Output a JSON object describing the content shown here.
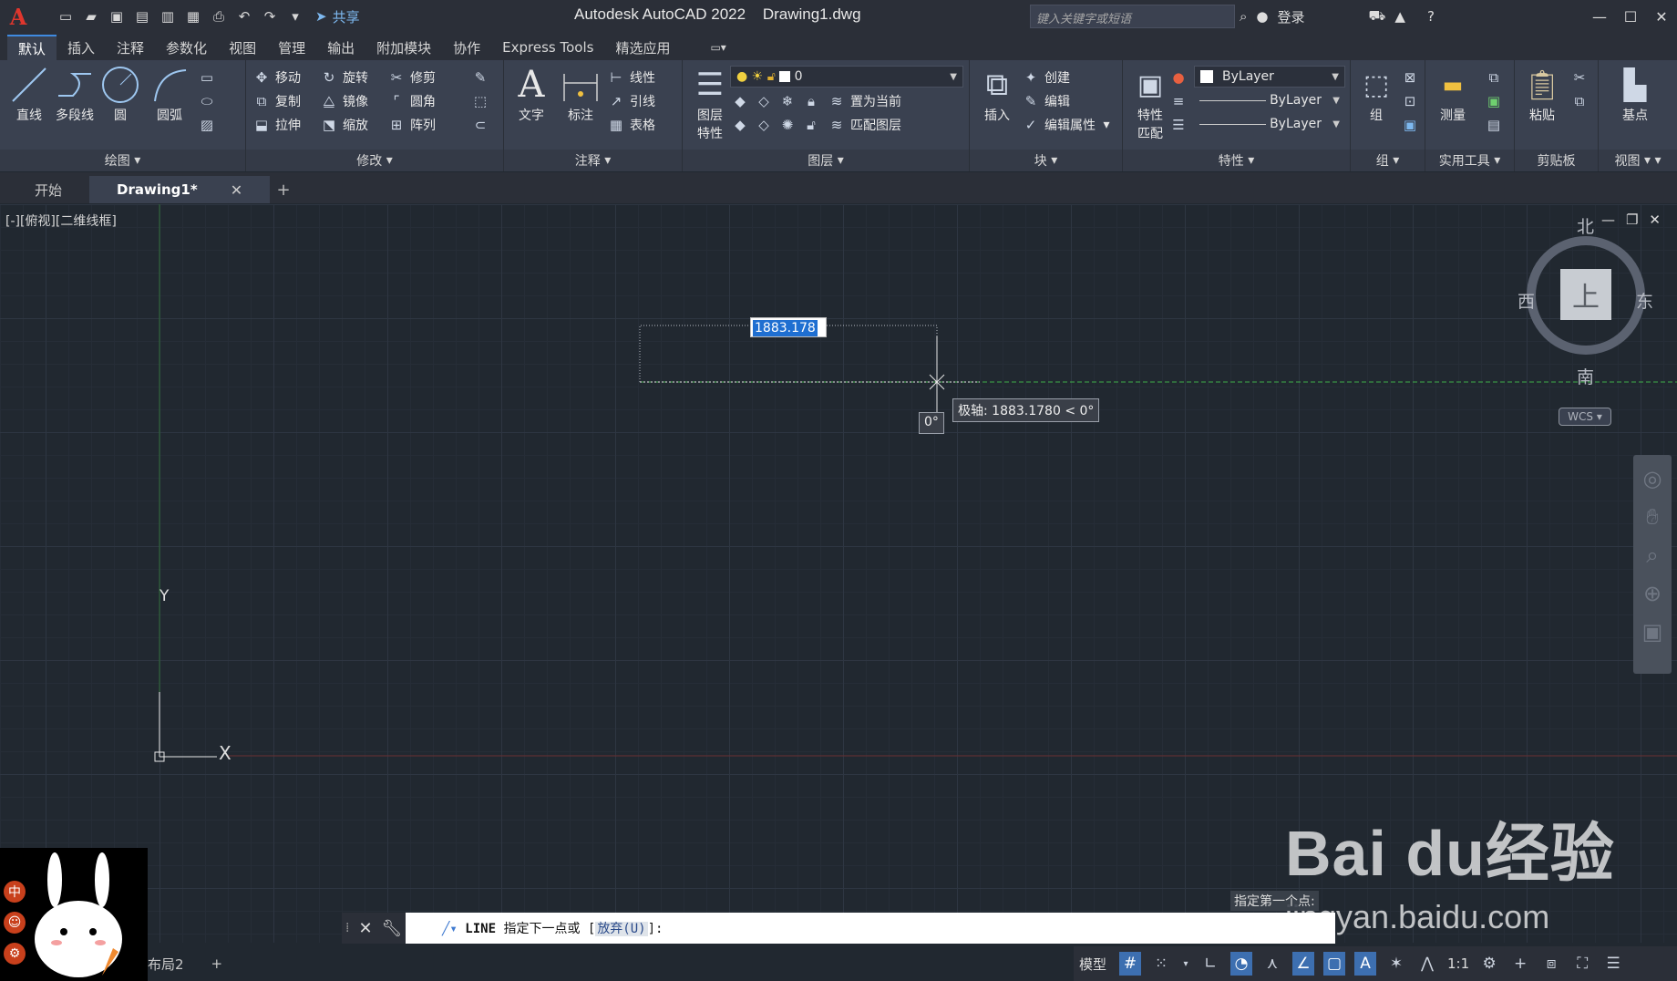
{
  "titlebar": {
    "logo": "A",
    "share_label": "共享",
    "app_title": "Autodesk AutoCAD 2022",
    "doc_title": "Drawing1.dwg",
    "search_placeholder": "键入关键字或短语",
    "login_label": "登录"
  },
  "ribbon_tabs": [
    "默认",
    "插入",
    "注释",
    "参数化",
    "视图",
    "管理",
    "输出",
    "附加模块",
    "协作",
    "Express Tools",
    "精选应用"
  ],
  "ribbon": {
    "draw": {
      "title": "绘图",
      "line": "直线",
      "polyline": "多段线",
      "circle": "圆",
      "arc": "圆弧"
    },
    "modify": {
      "title": "修改",
      "move": "移动",
      "rotate": "旋转",
      "trim": "修剪",
      "copy": "复制",
      "mirror": "镜像",
      "fillet": "圆角",
      "stretch": "拉伸",
      "scale": "缩放",
      "array": "阵列"
    },
    "annotation": {
      "title": "注释",
      "text": "文字",
      "dimension": "标注",
      "linear": "线性",
      "leader": "引线",
      "table": "表格"
    },
    "layers": {
      "title": "图层",
      "properties_line1": "图层",
      "properties_line2": "特性",
      "current_layer": "0",
      "set_current": "置为当前",
      "match_layer": "匹配图层"
    },
    "block": {
      "title": "块",
      "insert": "插入",
      "create": "创建",
      "edit": "编辑",
      "edit_attributes": "编辑属性"
    },
    "properties": {
      "title": "特性",
      "match_line1": "特性",
      "match_line2": "匹配",
      "color": "ByLayer",
      "linetype": "ByLayer",
      "lineweight": "ByLayer"
    },
    "groups": {
      "title": "组",
      "group": "组"
    },
    "utilities": {
      "title": "实用工具",
      "measure": "测量"
    },
    "clipboard": {
      "title": "剪贴板",
      "paste": "粘贴"
    },
    "view": {
      "title": "视图",
      "base": "基点"
    }
  },
  "doc_tabs": {
    "start": "开始",
    "drawing": "Drawing1*"
  },
  "viewport": {
    "label": "[-][俯视][二维线框]",
    "dim_input": "1883.178",
    "polar_tooltip": "极轴: 1883.1780 < 0°",
    "angle_tooltip": "0°",
    "ucs_y": "Y",
    "ucs_x": "X"
  },
  "viewcube": {
    "north": "北",
    "south": "南",
    "east": "东",
    "west": "西",
    "top": "上",
    "wcs": "WCS"
  },
  "command": {
    "prompt_history": "指定第一个点:",
    "command_name": "LINE",
    "command_text": "指定下一点或",
    "option": "放弃(U)",
    "suffix": "]:"
  },
  "layout_tabs": {
    "layout2": "布局2"
  },
  "statusbar": {
    "model": "模型",
    "scale": "1:1"
  },
  "watermark": {
    "brand": "Bai du经验",
    "url": "jingyan.baidu.com"
  },
  "ime": {
    "lang": "中"
  }
}
